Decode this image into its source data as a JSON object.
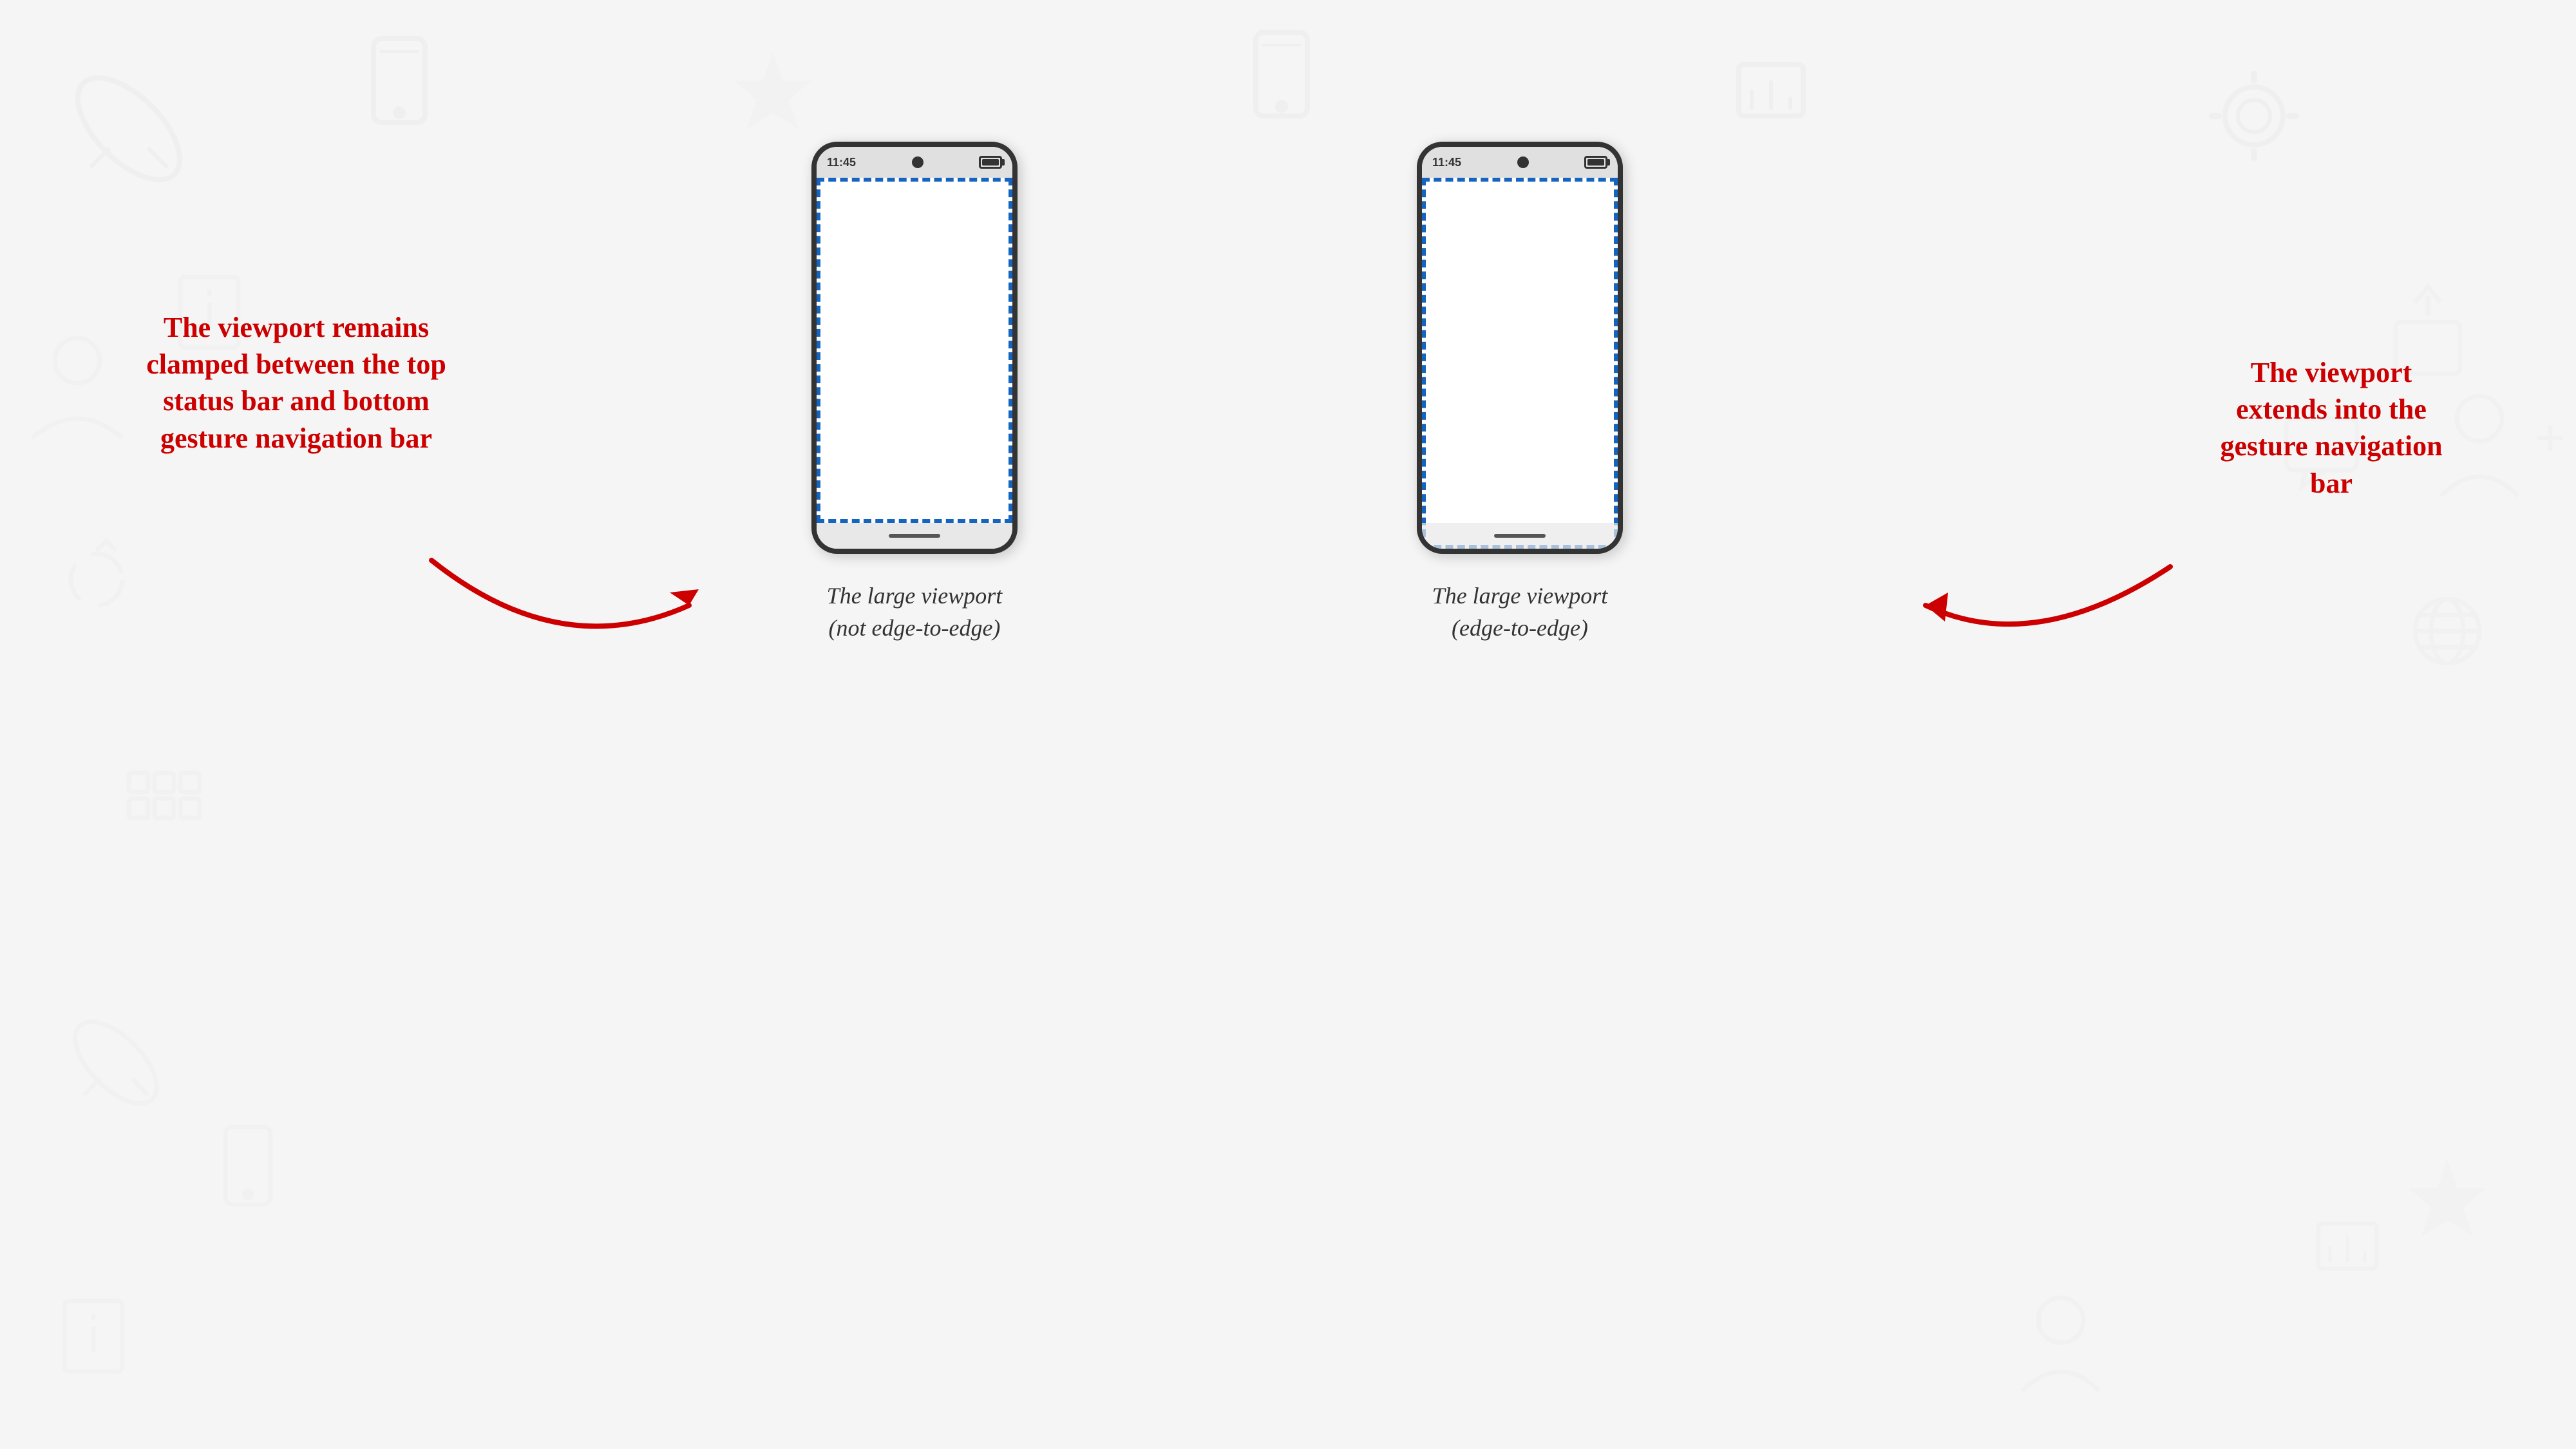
{
  "background": {
    "color": "#f5f5f5"
  },
  "phones": [
    {
      "id": "not-edge-to-edge",
      "status_bar": {
        "time": "11:45",
        "has_camera": true,
        "has_battery": true
      },
      "viewport_type": "clamped",
      "caption_line1": "The large viewport",
      "caption_line2": "(not edge-to-edge)"
    },
    {
      "id": "edge-to-edge",
      "status_bar": {
        "time": "11:45",
        "has_camera": true,
        "has_battery": true
      },
      "viewport_type": "edge",
      "caption_line1": "The large viewport",
      "caption_line2": "(edge-to-edge)"
    }
  ],
  "annotations": [
    {
      "id": "left-annotation",
      "text": "The viewport\nremains\nclamped\nbetween the\ntop status bar\nand bottom\ngesture\nnavigation bar"
    },
    {
      "id": "right-annotation",
      "text": "The viewport\nextends into the\ngesture navigation\nbar"
    }
  ],
  "captions": {
    "phone1_line1": "The large viewport",
    "phone1_line2": "(not edge-to-edge)",
    "phone2_line1": "The large viewport",
    "phone2_line2": "(edge-to-edge)"
  }
}
